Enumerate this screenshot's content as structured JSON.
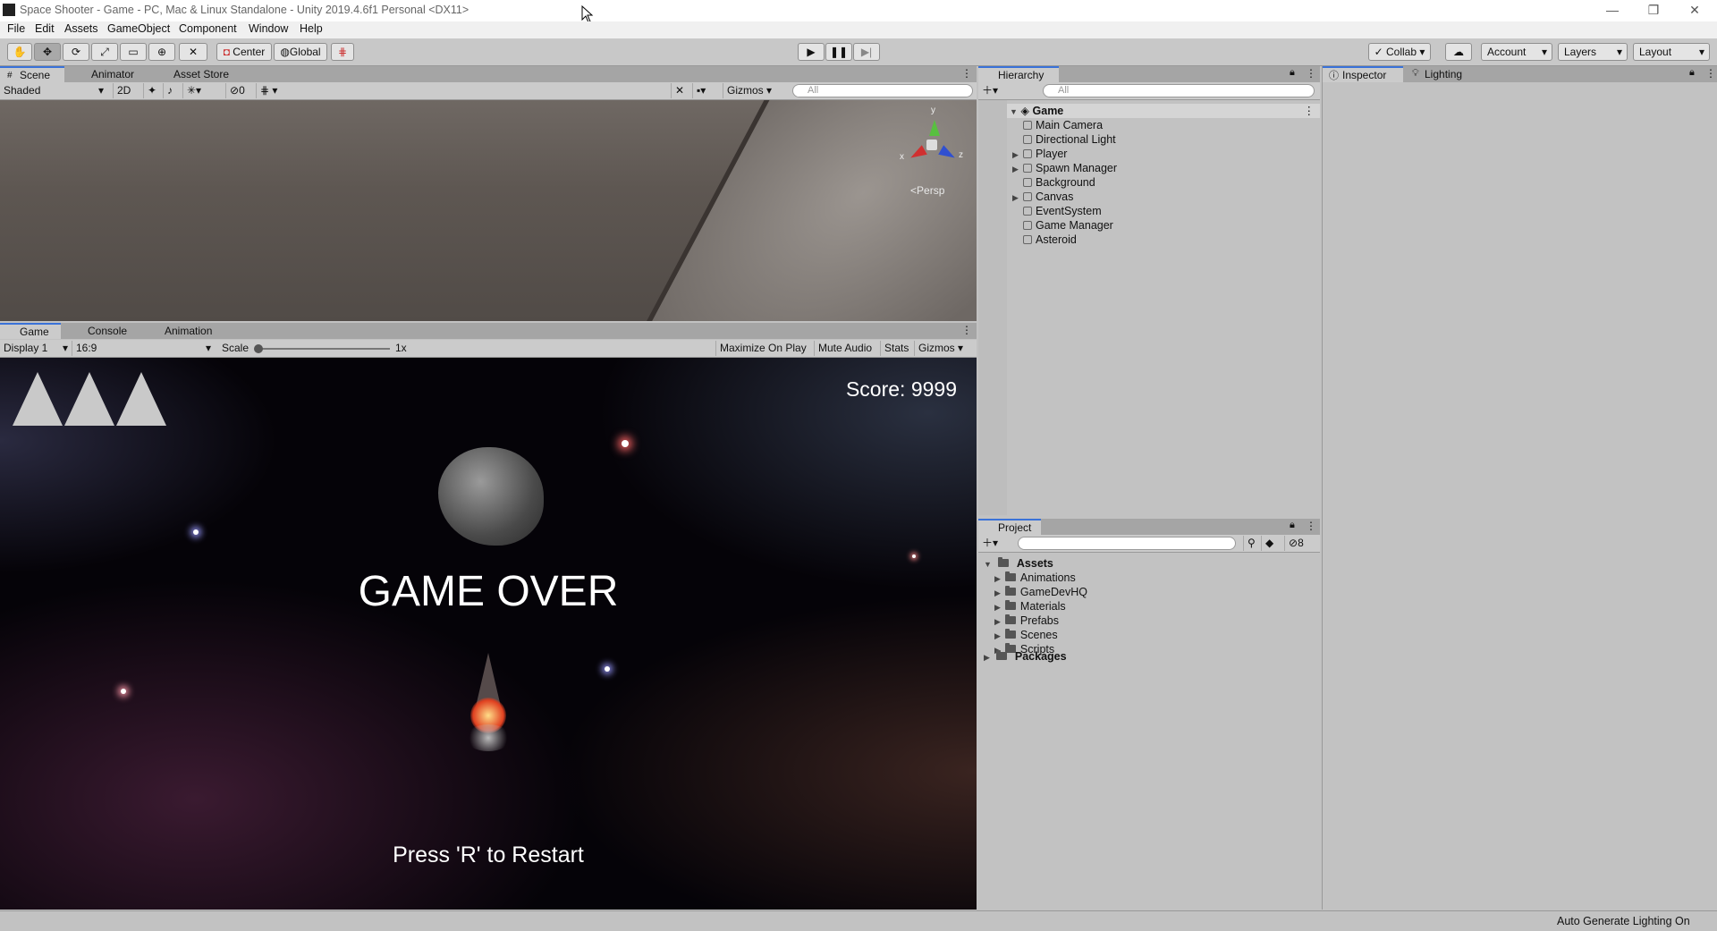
{
  "window": {
    "title": "Space Shooter - Game - PC, Mac & Linux Standalone - Unity 2019.4.6f1 Personal <DX11>",
    "minimize": "—",
    "maximize": "❐",
    "close": "✕"
  },
  "menu": [
    "File",
    "Edit",
    "Assets",
    "GameObject",
    "Component",
    "Window",
    "Help"
  ],
  "toolbar": {
    "pivot": "Center",
    "space": "Global",
    "collab": "Collab",
    "account": "Account",
    "layers": "Layers",
    "layout": "Layout"
  },
  "scene": {
    "tabs": [
      "Scene",
      "Animator",
      "Asset Store"
    ],
    "shading": "Shaded",
    "mode2d": "2D",
    "hidden_count": "0",
    "gizmos": "Gizmos",
    "search_placeholder": "All",
    "persp": "Persp",
    "axes": {
      "x": "x",
      "y": "y",
      "z": "z"
    }
  },
  "game": {
    "tabs": [
      "Game",
      "Console",
      "Animation"
    ],
    "display": "Display 1",
    "aspect": "16:9",
    "scale_label": "Scale",
    "scale_value": "1x",
    "scale_level": 0,
    "maximize_on_play": "Maximize On Play",
    "mute_audio": "Mute Audio",
    "stats": "Stats",
    "gizmos": "Gizmos",
    "score": "Score: 9999",
    "lives": 3,
    "game_over": "GAME OVER",
    "restart": "Press 'R' to Restart"
  },
  "hierarchy": {
    "tab": "Hierarchy",
    "search_placeholder": "All",
    "scene": "Game",
    "items": [
      {
        "label": "Main Camera",
        "expandable": false
      },
      {
        "label": "Directional Light",
        "expandable": false
      },
      {
        "label": "Player",
        "expandable": true
      },
      {
        "label": "Spawn Manager",
        "expandable": true
      },
      {
        "label": "Background",
        "expandable": false
      },
      {
        "label": "Canvas",
        "expandable": true
      },
      {
        "label": "EventSystem",
        "expandable": false
      },
      {
        "label": "Game Manager",
        "expandable": false
      },
      {
        "label": "Asteroid",
        "expandable": false
      }
    ]
  },
  "project": {
    "tab": "Project",
    "hidden_count": "8",
    "root": "Assets",
    "folders": [
      "Animations",
      "GameDevHQ",
      "Materials",
      "Prefabs",
      "Scenes",
      "Scripts"
    ],
    "packages": "Packages"
  },
  "inspector": {
    "tabs": [
      "Inspector",
      "Lighting"
    ]
  },
  "status": {
    "text": "Auto Generate Lighting On"
  },
  "colors": {
    "accent": "#3a72d8",
    "panel": "#c2c2c2",
    "game_bg": "#050308"
  }
}
